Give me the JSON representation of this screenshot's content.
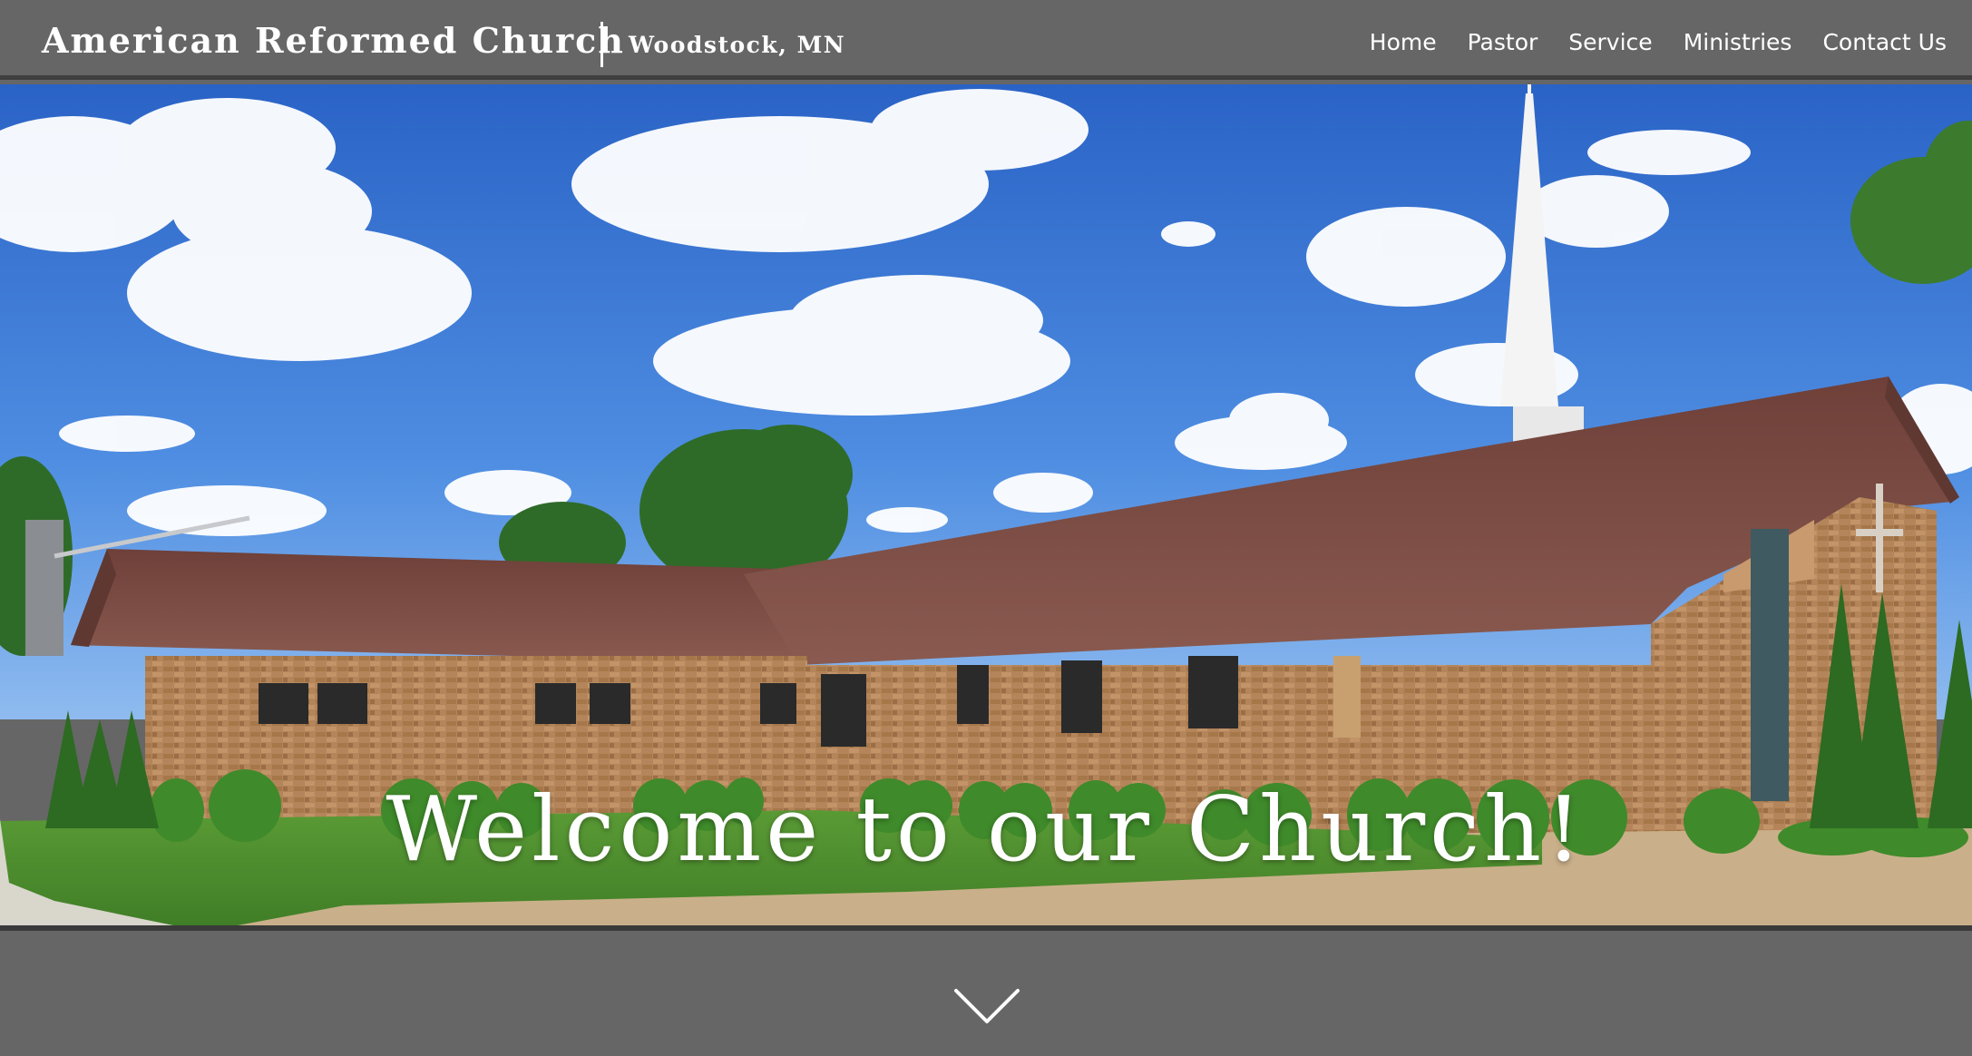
{
  "header": {
    "site_title": "American Reformed Church",
    "location": "Woodstock, MN"
  },
  "nav": {
    "items": [
      {
        "label": "Home"
      },
      {
        "label": "Pastor"
      },
      {
        "label": "Service"
      },
      {
        "label": "Ministries"
      },
      {
        "label": "Contact Us"
      }
    ]
  },
  "hero": {
    "headline": "Welcome to our Church!",
    "image_alt": "church-building-photo"
  },
  "colors": {
    "bar": "#666666",
    "divider": "#3f3f3f",
    "text": "#ffffff",
    "sky": "#2f6fd0",
    "roof": "#7a4a42",
    "brick": "#b4855a",
    "grass": "#4f8f2e",
    "dirt": "#c9b08a"
  },
  "icons": {
    "scroll": "chevron-down-icon"
  }
}
